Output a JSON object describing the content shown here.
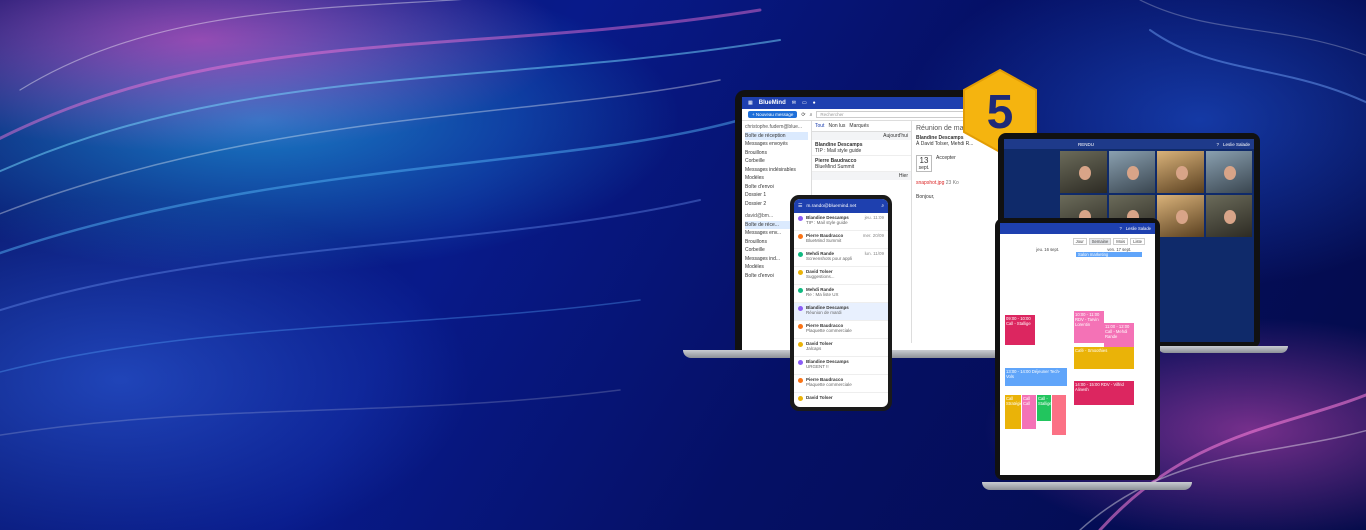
{
  "badge": {
    "number": "5"
  },
  "laptop": {
    "brand": "BlueMind",
    "new_message": "+ Nouveau message",
    "search_placeholder": "Rechercher",
    "filters": [
      "Tout",
      "Non lus",
      "Marqués"
    ],
    "account1": "christophe.fudem@blue...",
    "account2": "david@bm...",
    "folders": [
      "Boîte de réception",
      "Messages envoyés",
      "Brouillons",
      "Corbeille",
      "Messages indésirables",
      "Modèles",
      "Boîte d'envoi",
      "Dossier 1",
      "Dossier 2"
    ],
    "folders2": [
      "Boîte de réce...",
      "Messages env...",
      "Brouillons",
      "Corbeille",
      "Messages ind...",
      "Modèles",
      "Boîte d'envoi"
    ],
    "day_today": "Aujourd'hui",
    "day_yesterday": "Hier",
    "messages": [
      {
        "from": "Blandine Descamps",
        "subject": "TIP : Mail style guide",
        "time": "11:09"
      },
      {
        "from": "Pierre Baudracco",
        "subject": "BlueMind Summit",
        "time": "10:20"
      }
    ],
    "reader_title": "Réunion de ma...",
    "reader_from": "Blandine Descamps",
    "reader_to": "À David Tolser, Mehdi R...",
    "reader_date": "13",
    "reader_month": "sept.",
    "reader_label": "Accepter",
    "attachment": "snapshot.jpg",
    "attachment_size": "23 Ko",
    "body": "Bonjour,"
  },
  "phone": {
    "account": "m.rando@bluemind.net",
    "items": [
      {
        "from": "Blandine Descamps",
        "subject": "TIP : Mail style guide",
        "time": "jeu. 11:09",
        "color": "#8b5cf6"
      },
      {
        "from": "Pierre Baudracco",
        "subject": "BlueMind Summit",
        "time": "mer. 20/09",
        "color": "#f97316"
      },
      {
        "from": "Mehdi Rande",
        "subject": "Screenshots pour appli",
        "time": "lun. 11/09",
        "color": "#10b981"
      },
      {
        "from": "David Tolser",
        "subject": "Suggestions...",
        "time": "",
        "color": "#eab308"
      },
      {
        "from": "Mehdi Rande",
        "subject": "Re : Ma liste UX",
        "time": "",
        "color": "#10b981"
      },
      {
        "from": "Blandine Descamps",
        "subject": "Réunion de mardi",
        "time": "",
        "color": "#8b5cf6"
      },
      {
        "from": "Pierre Baudracco",
        "subject": "Plaquette commerciale",
        "time": "",
        "color": "#f97316"
      },
      {
        "from": "David Tolser",
        "subject": "Jalcaps",
        "time": "",
        "color": "#eab308"
      },
      {
        "from": "Blandine Descamps",
        "subject": "URGENT !!",
        "time": "",
        "color": "#8b5cf6"
      },
      {
        "from": "Pierre Baudracco",
        "subject": "Plaquette commerciale",
        "time": "",
        "color": "#f97316"
      },
      {
        "from": "David Tolser",
        "subject": "",
        "time": "",
        "color": "#eab308"
      }
    ]
  },
  "video": {
    "user": "Leslie Salade",
    "meeting": "RENDU"
  },
  "calendar": {
    "user": "Leslie Salade",
    "views": [
      "Jour",
      "Semaine",
      "Mois",
      "Liste"
    ],
    "days": [
      "jeu. 16 sept.",
      "ven. 17 sept."
    ],
    "allday": "Salon marketing",
    "events": [
      {
        "label": "09:00 - 10:00 Call - Stallige",
        "color": "#dc2660"
      },
      {
        "label": "10:00 - 11:00 RDV - Tarvin Lorentin",
        "color": "#f472b6"
      },
      {
        "label": "11:00 - 12:00 Call - Mehdi Rande",
        "color": "#f472b6"
      },
      {
        "label": "Café - Smoothies",
        "color": "#eab308"
      },
      {
        "label": "13:00 - 14:00 Déjeuner Tech-Vols",
        "color": "#60a5fa"
      },
      {
        "label": "14:00 - 15:00 RDV - Vilfrid Alinesh",
        "color": "#dc2660"
      },
      {
        "label": "Call Stratégie",
        "color": "#eab308"
      },
      {
        "label": "Call Call",
        "color": "#f472b6"
      },
      {
        "label": "Call - Stallige",
        "color": "#22c55e"
      }
    ]
  }
}
